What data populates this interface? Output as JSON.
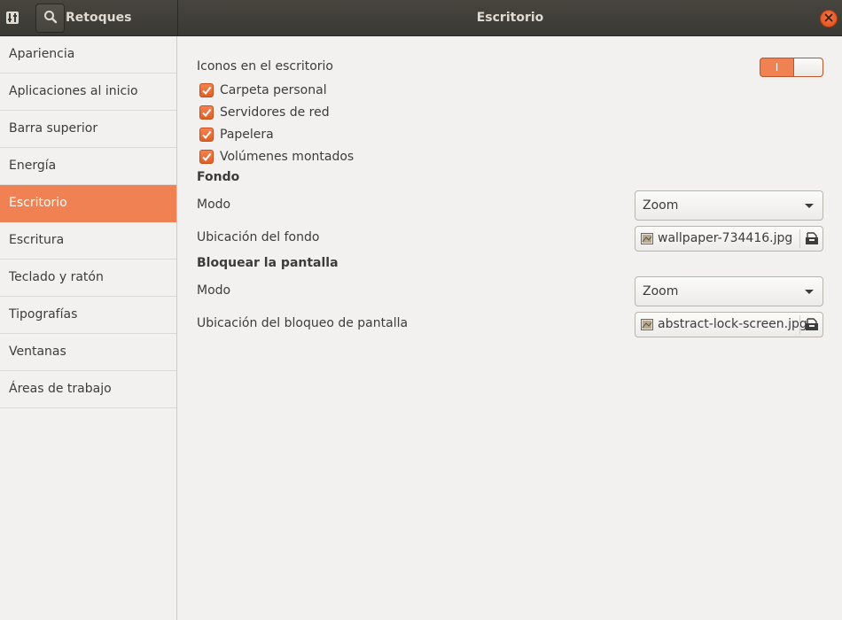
{
  "header": {
    "app_title": "Retoques",
    "window_title": "Escritorio",
    "icons": {
      "app": "tweaks-app-icon",
      "search": "search-icon",
      "close": "close-icon"
    },
    "accent_color": "#f08152",
    "close_color": "#df4a16"
  },
  "sidebar": {
    "items": [
      {
        "label": "Apariencia",
        "active": false
      },
      {
        "label": "Aplicaciones al inicio",
        "active": false
      },
      {
        "label": "Barra superior",
        "active": false
      },
      {
        "label": "Energía",
        "active": false
      },
      {
        "label": "Escritorio",
        "active": true
      },
      {
        "label": "Escritura",
        "active": false
      },
      {
        "label": "Teclado y ratón",
        "active": false
      },
      {
        "label": "Tipografías",
        "active": false
      },
      {
        "label": "Ventanas",
        "active": false
      },
      {
        "label": "Áreas de trabajo",
        "active": false
      }
    ]
  },
  "main": {
    "desktop_icons": {
      "label": "Iconos en el escritorio",
      "switch_on_text": "I",
      "switch_state": true,
      "checkboxes": [
        {
          "label": "Carpeta personal",
          "checked": true
        },
        {
          "label": "Servidores de red",
          "checked": true
        },
        {
          "label": "Papelera",
          "checked": true
        },
        {
          "label": "Volúmenes montados",
          "checked": true
        }
      ]
    },
    "background": {
      "section_title": "Fondo",
      "mode_label": "Modo",
      "mode_value": "Zoom",
      "location_label": "Ubicación del fondo",
      "location_file": "wallpaper-734416.jpg"
    },
    "lock_screen": {
      "section_title": "Bloquear la pantalla",
      "mode_label": "Modo",
      "mode_value": "Zoom",
      "location_label": "Ubicación del bloqueo de pantalla",
      "location_file": "abstract-lock-screen.jpg"
    }
  }
}
